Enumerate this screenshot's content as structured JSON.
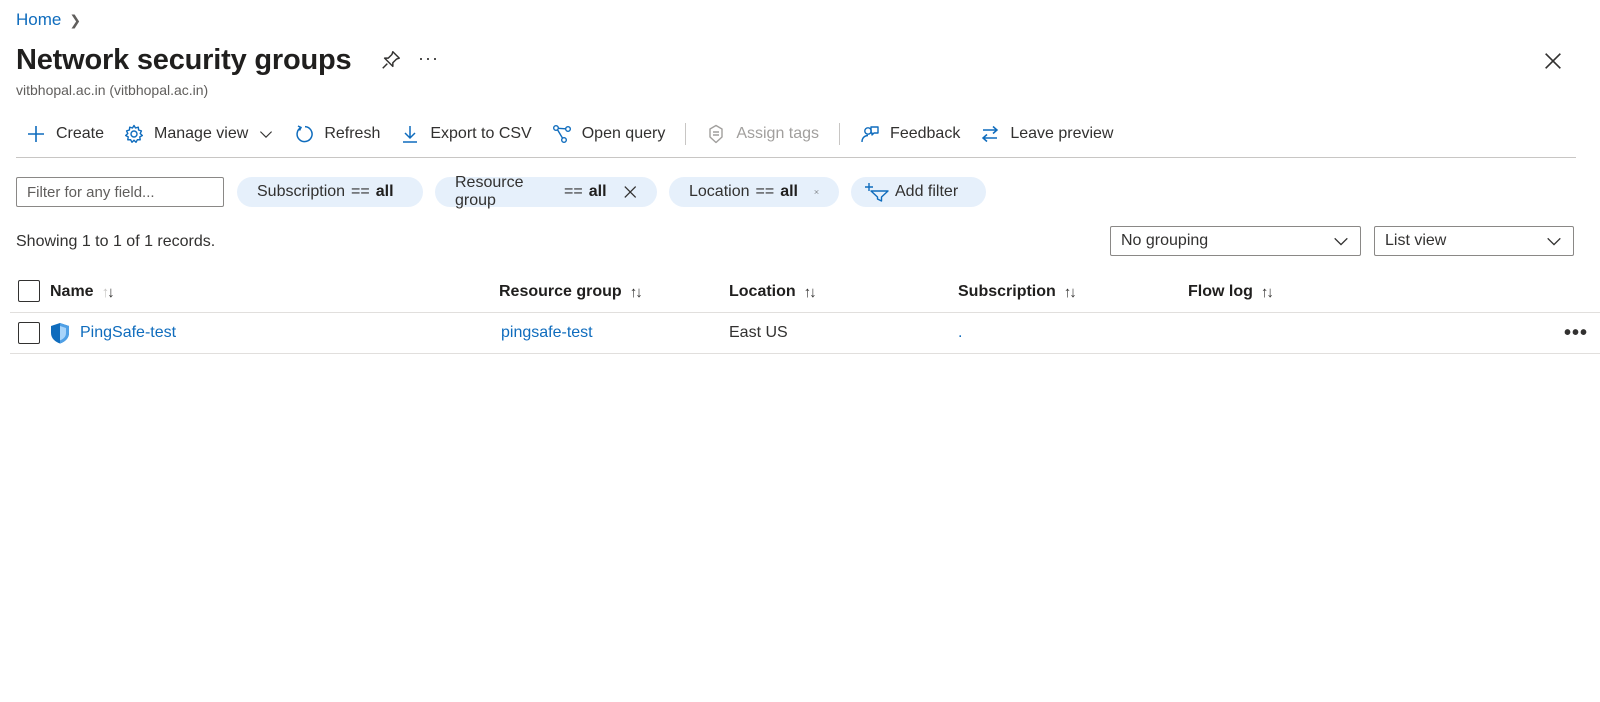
{
  "breadcrumb": {
    "home": "Home"
  },
  "page": {
    "title": "Network security groups",
    "subtitle": "vitbhopal.ac.in (vitbhopal.ac.in)",
    "more_label": "···"
  },
  "toolbar": {
    "create": "Create",
    "manage_view": "Manage view",
    "refresh": "Refresh",
    "export_csv": "Export to CSV",
    "open_query": "Open query",
    "assign_tags": "Assign tags",
    "feedback": "Feedback",
    "leave_preview": "Leave preview"
  },
  "filters": {
    "search_placeholder": "Filter for any field...",
    "pills": [
      {
        "key": "Subscription",
        "op": "==",
        "value": "all"
      },
      {
        "key": "Resource group",
        "op": "==",
        "value": "all"
      },
      {
        "key": "Location",
        "op": "==",
        "value": "all"
      }
    ],
    "add_filter": "Add filter"
  },
  "status": {
    "records": "Showing 1 to 1 of 1 records.",
    "grouping": "No grouping",
    "view": "List view"
  },
  "table": {
    "columns": [
      "Name",
      "Resource group",
      "Location",
      "Subscription",
      "Flow log"
    ],
    "sort_glyph": "↑↓",
    "rows": [
      {
        "name": "PingSafe-test",
        "resource_group": "pingsafe-test",
        "location": "East US",
        "subscription": ".",
        "flow_log": "",
        "more": "•••"
      }
    ]
  },
  "colors": {
    "accent": "#0f6cbd",
    "pill_bg": "#e6f0fb",
    "text": "#323130"
  }
}
